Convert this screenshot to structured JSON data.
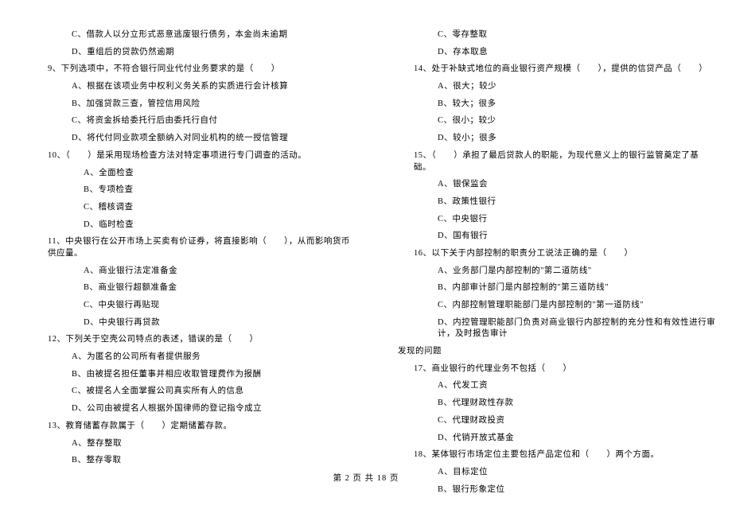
{
  "left": {
    "pre_opts": [
      "C、借款人以分立形式恶意逃废银行债务，本金尚未逾期",
      "D、重组后的贷款仍然逾期"
    ],
    "q9": {
      "stem": "9、下列选项中，不符合银行同业代付业务要求的是（　　）",
      "opts": [
        "A、根据在该项业务中权利义务关系的实质进行会计核算",
        "B、加强贷款三查，管控信用风险",
        "C、将资金拆给委托行后由委托行自付",
        "D、将代付同业款项全额纳入对同业机构的统一授信管理"
      ]
    },
    "q10": {
      "stem": "10、（　　）是采用现场检查方法对特定事项进行专门调查的活动。",
      "opts": [
        "A、全面检查",
        "B、专项检查",
        "C、稽核调查",
        "D、临时检查"
      ]
    },
    "q11": {
      "stem": "11、中央银行在公开市场上买卖有价证券，将直接影响（　　），从而影响货币供应量。",
      "opts": [
        "A、商业银行法定准备金",
        "B、商业银行超额准备金",
        "C、中央银行再贴现",
        "D、中央银行再贷款"
      ]
    },
    "q12": {
      "stem": "12、下列关于空壳公司特点的表述，错误的是（　　）",
      "opts": [
        "A、为匿名的公司所有者提供服务",
        "B、由被提名担任董事并相应收取管理费作为报酬",
        "C、被提名人全面掌握公司真实所有人的信息",
        "D、公司由被提名人根据外国律师的登记指令成立"
      ]
    },
    "q13": {
      "stem": "13、教育储蓄存款属于（　　）定期储蓄存款。",
      "opts": [
        "A、整存整取",
        "B、整存零取"
      ]
    }
  },
  "right": {
    "pre_opts": [
      "C、零存整取",
      "D、存本取息"
    ],
    "q14": {
      "stem": "14、处于补缺式地位的商业银行资产规模（　　），提供的信贷产品（　　）",
      "opts": [
        "A、很大；较少",
        "B、较大；很多",
        "C、很小；较少",
        "D、较小；很多"
      ]
    },
    "q15": {
      "stem": "15、（　　）承担了最后贷款人的职能，为现代意义上的银行监管奠定了基础。",
      "opts": [
        "A、银保监会",
        "B、政策性银行",
        "C、中央银行",
        "D、国有银行"
      ]
    },
    "q16": {
      "stem": "16、以下关于内部控制的职责分工说法正确的是（　　）",
      "opts": [
        "A、业务部门是内部控制的\"第二道防线\"",
        "B、内部审计部门是内部控制的\"第三道防线\"",
        "C、内部控制管理职能部门是内部控制的\"第一道防线\"",
        "D、内控管理职能部门负责对商业银行内部控制的充分性和有效性进行审计，及时报告审计"
      ],
      "cont": "发现的问题"
    },
    "q17": {
      "stem": "17、商业银行的代理业务不包括（　　）",
      "opts": [
        "A、代发工资",
        "B、代理财政性存款",
        "C、代理财政投资",
        "D、代销开放式基金"
      ]
    },
    "q18": {
      "stem": "18、某体银行市场定位主要包括产品定位和（　　）两个方面。",
      "opts": [
        "A、目标定位",
        "B、银行形象定位"
      ]
    }
  },
  "footer": "第 2 页 共 18 页"
}
